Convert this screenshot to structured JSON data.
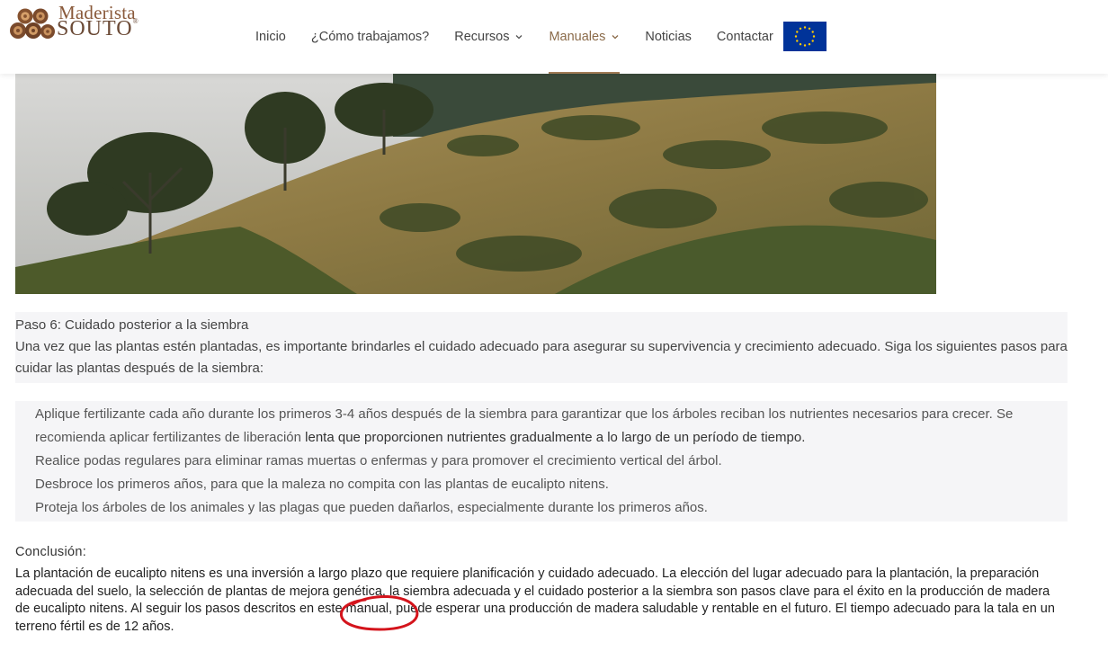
{
  "brand": {
    "line1": "Maderista",
    "line2": "SOUTO",
    "reg": "®"
  },
  "nav": {
    "items": [
      {
        "label": "Inicio",
        "dropdown": false
      },
      {
        "label": "¿Cómo trabajamos?",
        "dropdown": false
      },
      {
        "label": "Recursos",
        "dropdown": true
      },
      {
        "label": "Manuales",
        "dropdown": true,
        "active": true
      },
      {
        "label": "Noticias",
        "dropdown": false
      },
      {
        "label": "Contactar",
        "dropdown": false
      }
    ],
    "flag_icon": "eu-flag-icon"
  },
  "article": {
    "step_title": "Paso 6: Cuidado posterior a la siembra",
    "step_intro": "Una vez que las plantas estén plantadas, es importante brindarles el cuidado adecuado para asegurar su supervivencia y crecimiento adecuado. Siga los siguientes pasos para cuidar las plantas después de la siembra:",
    "list": [
      {
        "part1": "Aplique fertilizante cada año durante los primeros 3-4 años después de la siembra para garantizar que los árboles reciban los nutrientes necesarios para crecer. Se recomienda aplicar fertilizantes de liberación ",
        "part2": "lenta que proporcionen nutrientes gradualmente a lo largo de un período de tiempo."
      },
      {
        "part1": "Realice podas regulares para eliminar ramas muertas o enfermas y para promover el crecimiento vertical del árbol.",
        "part2": ""
      },
      {
        "part1": "Desbroce los primeros años, para que la maleza no compita con las plantas de eucalipto nitens.",
        "part2": ""
      },
      {
        "part1": "Proteja los árboles de los animales y las plagas que pueden dañarlos, especialmente durante los primeros años.",
        "part2": ""
      }
    ],
    "conclusion_title": "Conclusión:",
    "conclusion_text": "La plantación de eucalipto nitens es una inversión a largo plazo que requiere planificación y cuidado adecuado. La elección del lugar adecuado para la plantación, la preparación adecuada del suelo, la selección de plantas de mejora genética, la siembra adecuada y el cuidado posterior a la siembra son pasos clave para el éxito en la producción de madera de eucalipto nitens. Al seguir los pasos descritos en este manual, puede esperar una producción de madera saludable y rentable en el futuro. El tiempo adecuado para la tala en un terreno fértil es de 12 años."
  },
  "colors": {
    "accent": "#8b6b4a",
    "eu_blue": "#003399",
    "eu_star": "#ffcc00",
    "annotation_red": "#d4141c"
  }
}
